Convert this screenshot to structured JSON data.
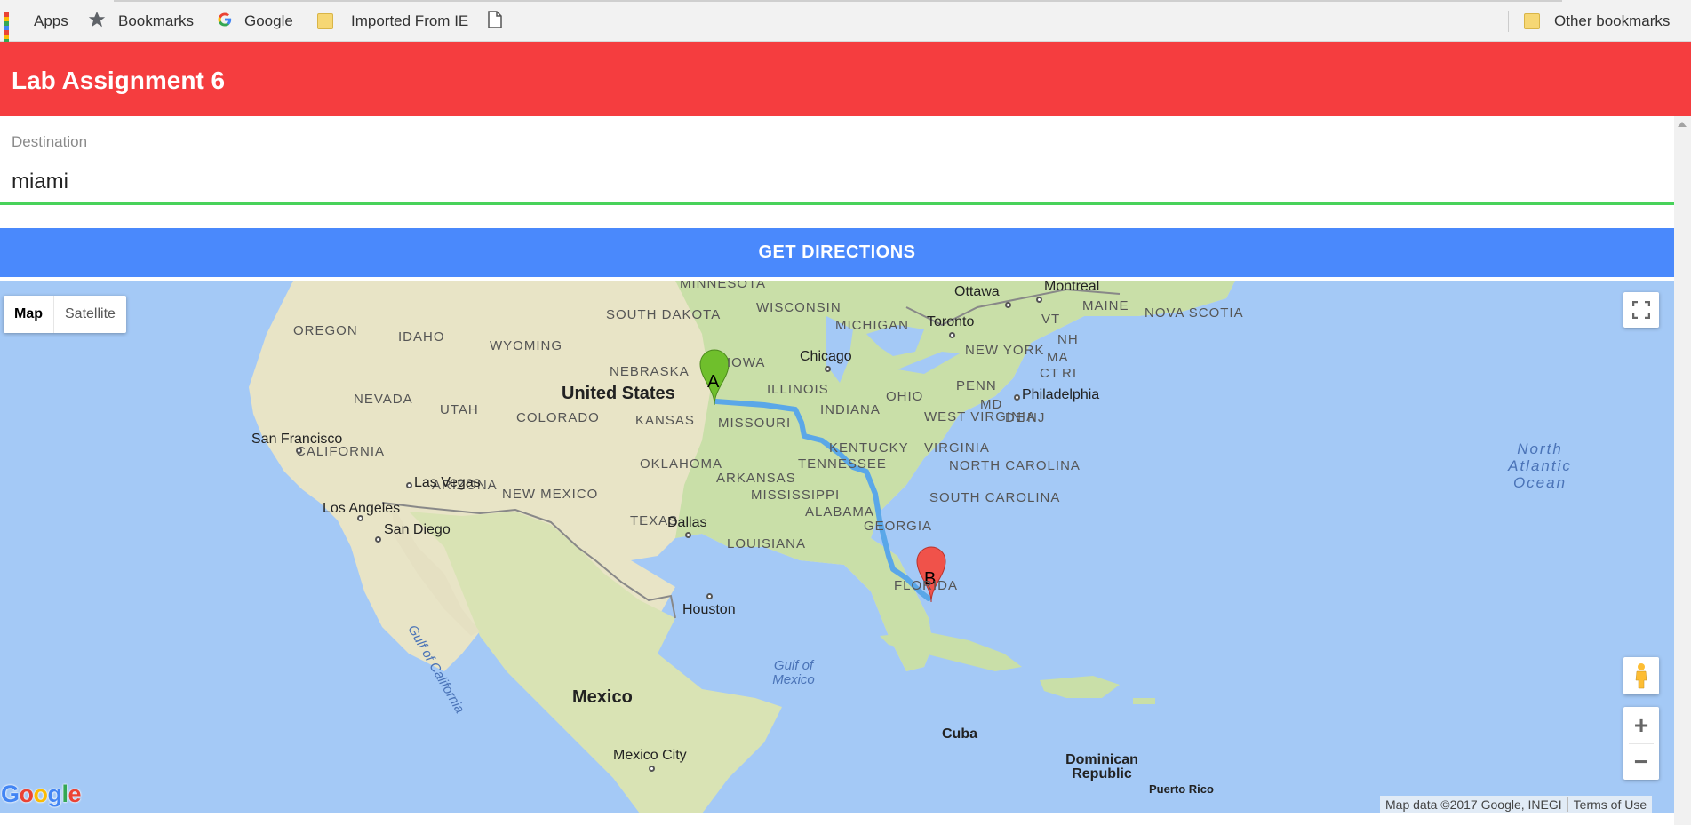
{
  "bookmarks": {
    "apps": "Apps",
    "bookmarks": "Bookmarks",
    "google": "Google",
    "imported": "Imported From IE",
    "other": "Other bookmarks"
  },
  "app": {
    "title": "Lab Assignment 6"
  },
  "form": {
    "destination_label": "Destination",
    "destination_value": "miami",
    "button_label": "GET DIRECTIONS"
  },
  "map": {
    "type_buttons": [
      "Map",
      "Satellite"
    ],
    "active_type": "Map",
    "markers": {
      "start": "A",
      "end": "B"
    },
    "states": [
      "OREGON",
      "IDAHO",
      "WYOMING",
      "SOUTH DAKOTA",
      "NEBRASKA",
      "IOWA",
      "NEVADA",
      "UTAH",
      "COLORADO",
      "KANSAS",
      "MISSOURI",
      "CALIFORNIA",
      "ARIZONA",
      "NEW MEXICO",
      "OKLAHOMA",
      "ARKANSAS",
      "TENNESSEE",
      "TEXAS",
      "LOUISIANA",
      "MISSISSIPPI",
      "ALABAMA",
      "GEORGIA",
      "FLORIDA",
      "ILLINOIS",
      "INDIANA",
      "OHIO",
      "KENTUCKY",
      "WISCONSIN",
      "MICHIGAN",
      "MINNESOTA",
      "WEST VIRGINIA",
      "VIRGINIA",
      "NORTH CAROLINA",
      "SOUTH CAROLINA",
      "PENN",
      "NEW YORK",
      "MAINE",
      "VT",
      "NH",
      "MA",
      "CT",
      "RI",
      "MD",
      "DE",
      "NJ",
      "NOVA SCOTIA"
    ],
    "cities": [
      "San Francisco",
      "Los Angeles",
      "San Diego",
      "Las Vegas",
      "Dallas",
      "Houston",
      "Chicago",
      "Toronto",
      "Ottawa",
      "Montreal",
      "Philadelphia",
      "Mexico City"
    ],
    "countries": [
      "United States",
      "Mexico",
      "Cuba",
      "Dominican Republic",
      "Puerto Rico"
    ],
    "water": [
      "Gulf of Mexico",
      "Gulf of California",
      "North Atlantic Ocean"
    ],
    "attribution": "Map data ©2017 Google, INEGI",
    "terms": "Terms of Use",
    "logo": "Google",
    "zoom_in": "+",
    "zoom_out": "−"
  },
  "colors": {
    "header": "#f53d3f",
    "button": "#4a89fc",
    "underline": "#48d25a",
    "route": "#5aa7e8",
    "marker_a": "#6fbf2c",
    "marker_b": "#f0524a",
    "water": "#a4c9f6"
  },
  "icons": [
    "apps-grid-icon",
    "star-icon",
    "google-g-icon",
    "folder-icon",
    "page-icon",
    "fullscreen-icon",
    "pegman-icon"
  ]
}
